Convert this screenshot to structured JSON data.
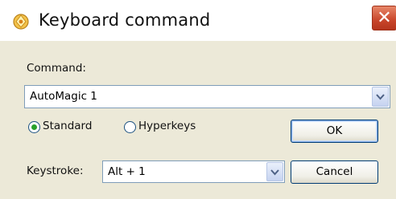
{
  "window": {
    "title": "Keyboard command",
    "close_glyph": "✕",
    "app_icon": "automagic-icon"
  },
  "command": {
    "label": "Command:",
    "value": "AutoMagic 1"
  },
  "mode": {
    "options": [
      "Standard",
      "Hyperkeys"
    ],
    "selected": "Standard"
  },
  "keystroke": {
    "label": "Keystroke:",
    "value": "Alt + 1"
  },
  "buttons": {
    "ok": "OK",
    "cancel": "Cancel"
  },
  "colors": {
    "accent": "#2aa12a",
    "close": "#c8452a",
    "border": "#7f9db9"
  }
}
